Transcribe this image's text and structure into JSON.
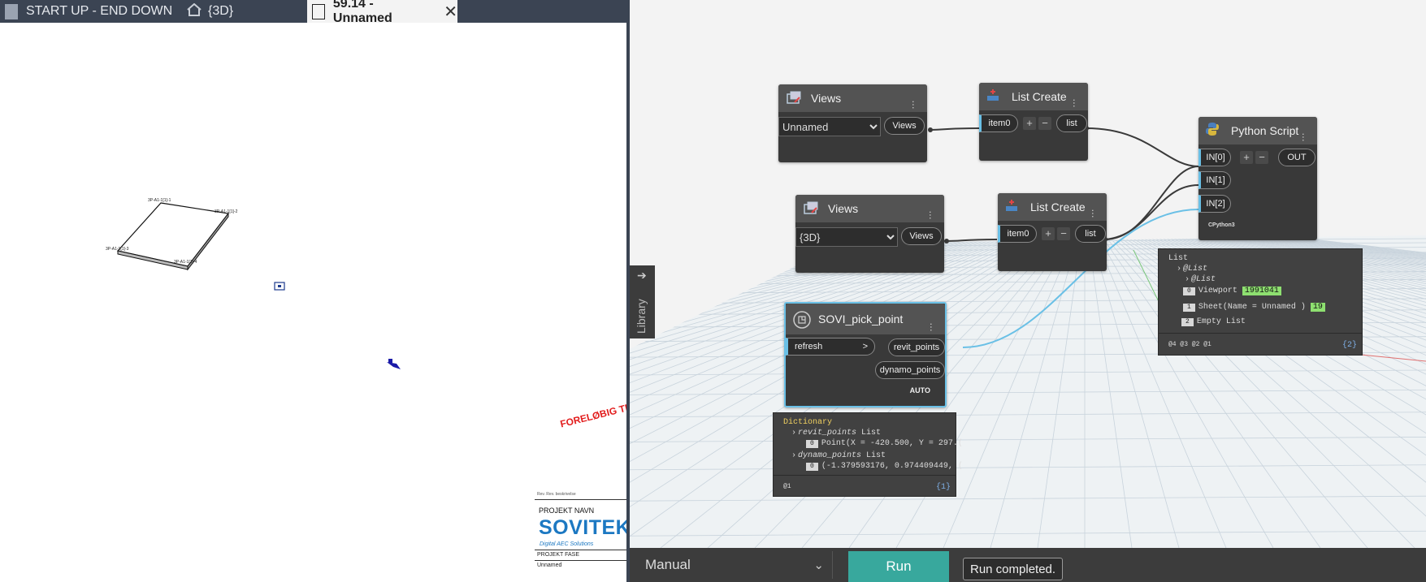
{
  "revit": {
    "tabs": [
      {
        "label": "START UP - END DOWN"
      },
      {
        "label": "{3D}"
      },
      {
        "label": "59.14 - Unnamed"
      }
    ],
    "titleblock": {
      "rev_line": "Rev.  Rev. beskrivelse",
      "project_label": "PROJEKT NAVN",
      "brand": "SOVITEK",
      "brand_sub": "Digital AEC Solutions",
      "phase": "PROJEKT FASE",
      "sheet_name": "Unnamed"
    },
    "stamp": "FORELØBIG TR"
  },
  "dynamo": {
    "nodes": {
      "views1": {
        "title": "Views",
        "selected": "Unnamed",
        "output": "Views"
      },
      "views2": {
        "title": "Views",
        "selected": "{3D}",
        "output": "Views"
      },
      "listcreate1": {
        "title": "List Create",
        "input": "item0",
        "output": "list"
      },
      "listcreate2": {
        "title": "List Create",
        "input": "item0",
        "output": "list"
      },
      "python": {
        "title": "Python Script",
        "inputs": [
          "IN[0]",
          "IN[1]",
          "IN[2]"
        ],
        "output": "OUT",
        "engine": "CPython3"
      },
      "pick": {
        "title": "SOVI_pick_point",
        "input": "refresh",
        "input_arrow": ">",
        "outputs": [
          "revit_points",
          "dynamo_points"
        ],
        "run_mode": "AUTO"
      }
    },
    "previews": {
      "python": {
        "root": "List",
        "l1": "@List",
        "l2": "@List",
        "i0": "0",
        "i0_text": "Viewport",
        "i0_id": "1991041",
        "i1": "1",
        "i1_text": "Sheet(Name = Unnamed )",
        "i1_id": "19",
        "i2": "2",
        "i2_text": "Empty List",
        "levels": "@4 @3 @2 @1",
        "count": "{2}"
      },
      "pick": {
        "root": "Dictionary",
        "k1": "revit_points",
        "k1_type": "List",
        "k1_i": "0",
        "k1_v": "Point(X = -420.500, Y = 297.(",
        "k2": "dynamo_points",
        "k2_type": "List",
        "k2_i": "0",
        "k2_v": "(-1.379593176, 0.974409449, (",
        "levels": "@1",
        "count": "{1}"
      }
    },
    "library_label": "Library",
    "bottombar": {
      "mode": "Manual",
      "run_label": "Run",
      "status": "Run completed."
    },
    "colors": {
      "accent": "#38a89d",
      "wire_blue": "#6ac0e6",
      "node_bg": "#393939",
      "node_head": "#535353"
    }
  }
}
